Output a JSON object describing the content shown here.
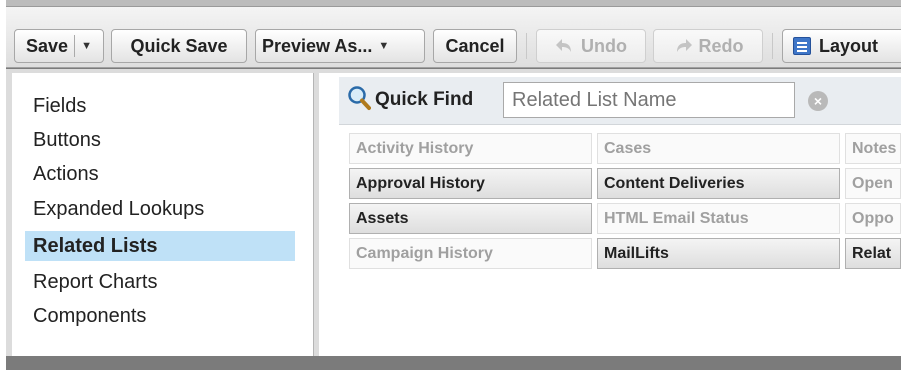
{
  "toolbar": {
    "save": "Save",
    "quick_save": "Quick Save",
    "preview_as": "Preview As...",
    "cancel": "Cancel",
    "undo": "Undo",
    "redo": "Redo",
    "layout": "Layout"
  },
  "sidebar": {
    "items": [
      {
        "label": "Fields",
        "active": false
      },
      {
        "label": "Buttons",
        "active": false
      },
      {
        "label": "Actions",
        "active": false
      },
      {
        "label": "Expanded Lookups",
        "active": false
      },
      {
        "label": "Related Lists",
        "active": true
      },
      {
        "label": "Report Charts",
        "active": false
      },
      {
        "label": "Components",
        "active": false
      }
    ]
  },
  "quick_find": {
    "label": "Quick Find",
    "placeholder": "Related List Name",
    "clear_icon": "close-icon"
  },
  "related_lists": {
    "columns": [
      [
        {
          "label": "Activity History",
          "state": "used"
        },
        {
          "label": "Approval History",
          "state": "available"
        },
        {
          "label": "Assets",
          "state": "available"
        },
        {
          "label": "Campaign History",
          "state": "used"
        }
      ],
      [
        {
          "label": "Cases",
          "state": "used"
        },
        {
          "label": "Content Deliveries",
          "state": "available"
        },
        {
          "label": "HTML Email Status",
          "state": "used"
        },
        {
          "label": "MailLifts",
          "state": "available"
        }
      ],
      [
        {
          "label": "Notes",
          "state": "used"
        },
        {
          "label": "Open",
          "state": "used"
        },
        {
          "label": "Oppo",
          "state": "used"
        },
        {
          "label": "Relat",
          "state": "available"
        }
      ]
    ]
  },
  "colors": {
    "active_item_bg": "#bfe1f7",
    "toolbar_bg": "#e8e8e8",
    "quick_find_bg": "#e9edf1"
  }
}
